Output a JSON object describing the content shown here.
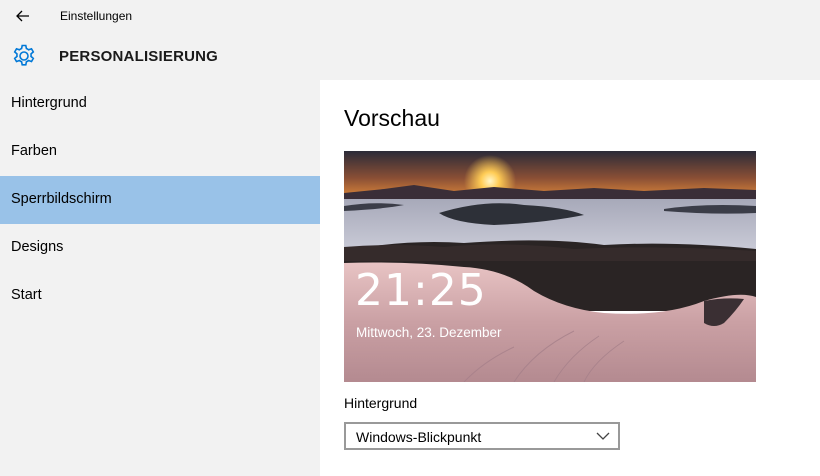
{
  "window": {
    "title": "Einstellungen"
  },
  "header": {
    "title": "PERSONALISIERUNG",
    "icon": "gear-icon"
  },
  "sidebar": {
    "items": [
      {
        "label": "Hintergrund",
        "active": false
      },
      {
        "label": "Farben",
        "active": false
      },
      {
        "label": "Sperrbildschirm",
        "active": true
      },
      {
        "label": "Designs",
        "active": false
      },
      {
        "label": "Start",
        "active": false
      }
    ]
  },
  "main": {
    "preview_heading": "Vorschau",
    "lockscreen": {
      "time": "21:25",
      "date": "Mittwoch, 23. Dezember"
    },
    "background_label": "Hintergrund",
    "background_select": {
      "value": "Windows-Blickpunkt"
    }
  },
  "colors": {
    "accent": "#0078d7",
    "active_nav": "#99c2e8",
    "chrome": "#f2f2f2"
  }
}
